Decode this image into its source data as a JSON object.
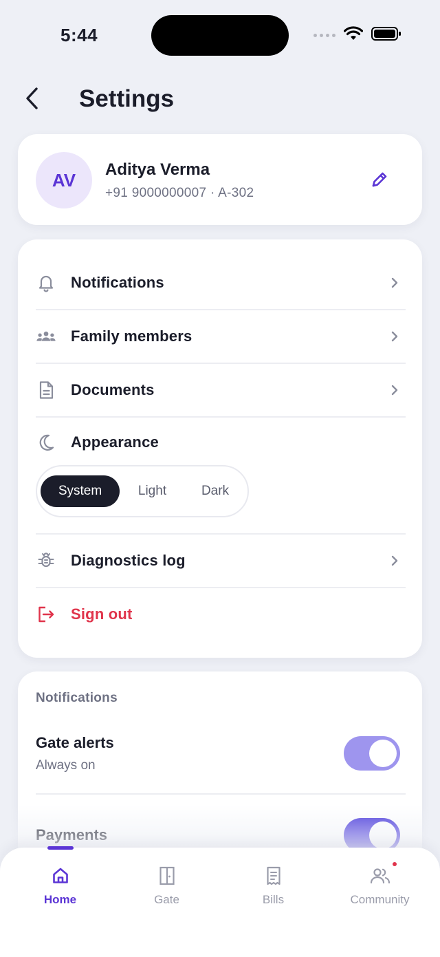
{
  "status_bar": {
    "time": "5:44"
  },
  "header": {
    "title": "Settings"
  },
  "profile": {
    "initials": "AV",
    "name": "Aditya Verma",
    "subtitle": "+91 9000000007 · A-302"
  },
  "menu": {
    "notifications": "Notifications",
    "family_members": "Family members",
    "documents": "Documents",
    "appearance": "Appearance",
    "appearance_options": [
      "System",
      "Light",
      "Dark"
    ],
    "appearance_selected": "System",
    "diagnostics_log": "Diagnostics log",
    "sign_out": "Sign out"
  },
  "notifications_section": {
    "title": "Notifications",
    "items": [
      {
        "title": "Gate alerts",
        "subtitle": "Always on",
        "enabled": true,
        "locked": true
      },
      {
        "title": "Payments",
        "enabled": true,
        "locked": false
      }
    ]
  },
  "tabbar": {
    "tabs": [
      {
        "label": "Home",
        "icon": "home-icon",
        "active": true
      },
      {
        "label": "Gate",
        "icon": "door-icon",
        "active": false
      },
      {
        "label": "Bills",
        "icon": "receipt-icon",
        "active": false
      },
      {
        "label": "Community",
        "icon": "people-icon",
        "active": false,
        "has_badge": true
      }
    ]
  },
  "colors": {
    "accent": "#5B35D5",
    "toggle_on": "#4F3FDD",
    "toggle_locked": "#9E95EE",
    "danger": "#E0344B",
    "background": "#EEF0F6",
    "text_primary": "#1B1D2A",
    "text_secondary": "#6E7183"
  }
}
